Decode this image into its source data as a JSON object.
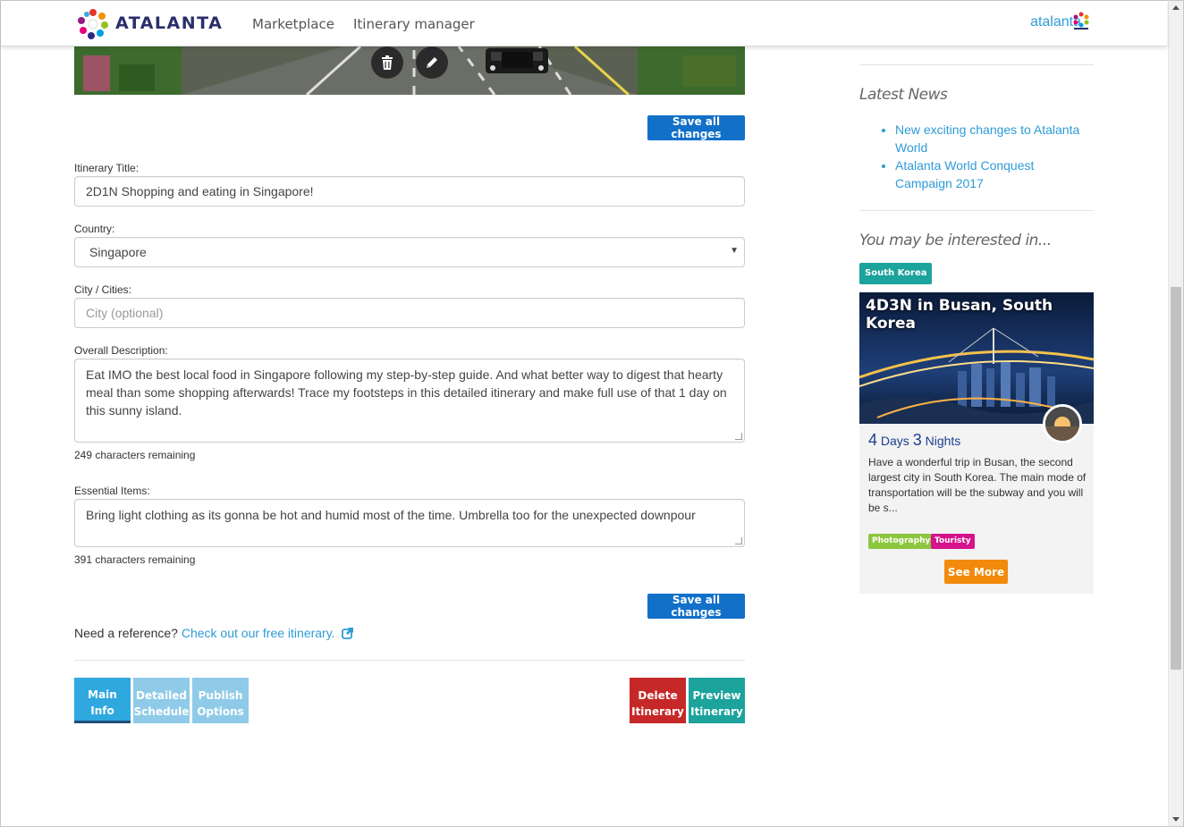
{
  "header": {
    "brand": "ATALANTA",
    "nav": [
      "Marketplace",
      "Itinerary manager"
    ],
    "user": "atalanta"
  },
  "hero": {
    "actions": [
      "trash-icon",
      "pencil-icon"
    ]
  },
  "form": {
    "save_label": "Save all changes",
    "title_label": "Itinerary Title:",
    "title_value": "2D1N Shopping and eating in Singapore!",
    "country_label": "Country:",
    "country_value": "Singapore",
    "city_label": "City / Cities:",
    "city_placeholder": "City (optional)",
    "desc_label": "Overall Description:",
    "desc_value": "Eat IMO the best local food in Singapore following my step-by-step guide. And what better way to digest that hearty meal than some shopping afterwards! Trace my footsteps in this detailed itinerary and make full use of that 1 day on this sunny island.",
    "desc_remaining": "249 characters remaining",
    "items_label": "Essential Items:",
    "items_value": "Bring light clothing as its gonna be hot and humid most of the time. Umbrella too for the unexpected downpour",
    "items_remaining": "391 characters remaining"
  },
  "reference": {
    "prefix": "Need a reference?",
    "link": "Check out our free itinerary."
  },
  "steps": {
    "main_line1": "Main",
    "main_line2": "Info",
    "detail_line1": "Detailed",
    "detail_line2": "Schedule",
    "publish_line1": "Publish",
    "publish_line2": "Options",
    "delete_line1": "Delete",
    "delete_line2": "Itinerary",
    "preview_line1": "Preview",
    "preview_line2": "Itinerary"
  },
  "sidebar": {
    "news_heading": "Latest News",
    "news": [
      "New exciting changes to Atalanta World",
      "Atalanta World Conquest Campaign 2017"
    ],
    "interest_heading": "You may be interested in...",
    "country_tag": "South Korea",
    "card": {
      "title": "4D3N in Busan, South Korea",
      "days_num": "4",
      "days_word": "Days",
      "nights_num": "3",
      "nights_word": "Nights",
      "description": "Have a wonderful trip in Busan, the second largest city in South Korea. The main mode of transportation will be the subway and you will be s...",
      "tags": [
        "Photography",
        "Touristy"
      ],
      "cta": "See More"
    }
  },
  "colors": {
    "primary": "#1270c9",
    "link": "#2e9bd6",
    "danger": "#c62828",
    "teal": "#1ba39c",
    "orange": "#f28a0c"
  }
}
